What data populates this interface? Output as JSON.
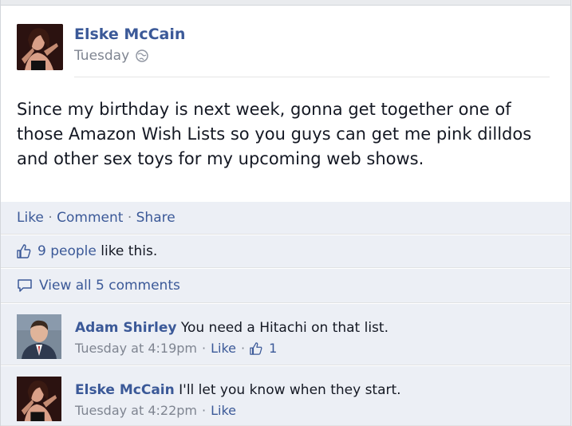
{
  "post": {
    "author": "Elske McCain",
    "time": "Tuesday",
    "text": "Since my birthday is next week, gonna get together one of those Amazon Wish Lists so you guys can get me pink dilldos and other sex toys for my upcoming web shows."
  },
  "actions": {
    "like": "Like",
    "comment": "Comment",
    "share": "Share",
    "separator": "·"
  },
  "likes": {
    "count_link": "9 people",
    "suffix": "like this."
  },
  "view_comments": "View all 5 comments",
  "comments": [
    {
      "author": "Adam Shirley",
      "text": "You need a Hitachi on that list.",
      "time": "Tuesday at 4:19pm",
      "like": "Like",
      "likes": "1"
    },
    {
      "author": "Elske McCain",
      "text": "I'll let you know when they start.",
      "time": "Tuesday at 4:22pm",
      "like": "Like"
    }
  ],
  "colors": {
    "link": "#3b5998",
    "meta": "#7f8591",
    "bar_bg": "#eceff5"
  }
}
